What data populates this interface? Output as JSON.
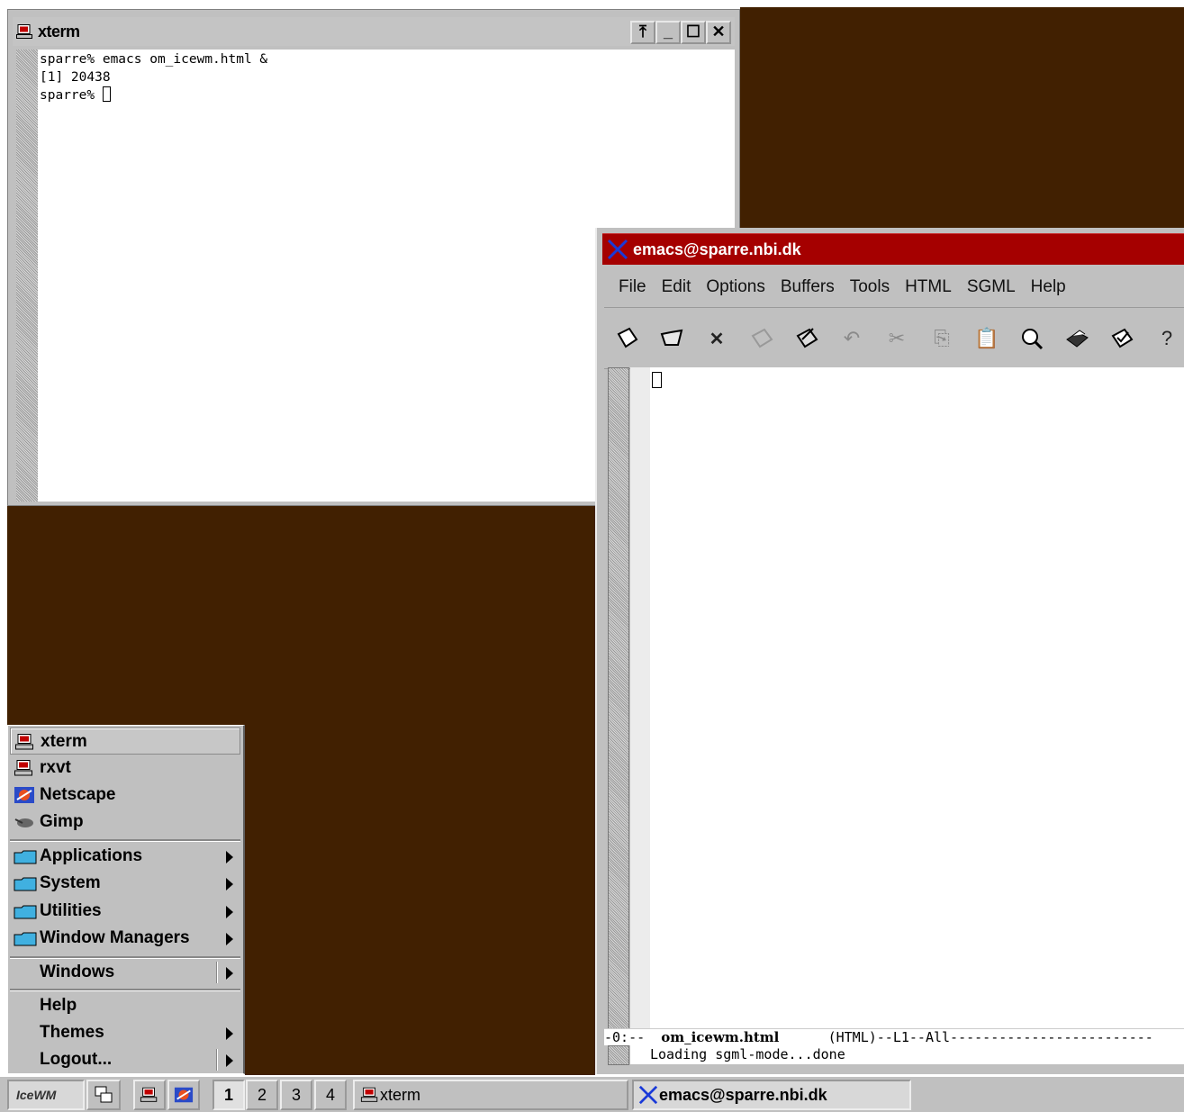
{
  "xterm": {
    "title": "xterm",
    "lines": [
      "sparre% emacs om_icewm.html &",
      "[1] 20438",
      "sparre% "
    ],
    "buttons": [
      "⤒",
      "_",
      "☐",
      "✕"
    ]
  },
  "emacs": {
    "title": "emacs@sparre.nbi.dk",
    "menu": [
      "File",
      "Edit",
      "Options",
      "Buffers",
      "Tools",
      "HTML",
      "SGML",
      "Help"
    ],
    "modeline_prefix": "-0:--  ",
    "modeline_buffer": "om_icewm.html",
    "modeline_rest": "      (HTML)--L1--All-------------------------",
    "minibuffer": "Loading sgml-mode...done"
  },
  "menu": {
    "items": [
      {
        "label": "xterm",
        "underline": "x"
      },
      {
        "label": "rxvt",
        "underline": "r"
      },
      {
        "label": "Netscape",
        "underline": "N"
      },
      {
        "label": "Gimp",
        "underline": "G"
      }
    ],
    "folders": [
      {
        "label": "Applications",
        "underline": "A"
      },
      {
        "label": "System",
        "underline": "S"
      },
      {
        "label": "Utilities",
        "underline": "U"
      },
      {
        "label": "Window Managers",
        "underline": "W"
      }
    ],
    "windows": "Windows",
    "help": "Help",
    "themes": "Themes",
    "logout": "Logout..."
  },
  "taskbar": {
    "logo": "IceWM",
    "workspaces": [
      "1",
      "2",
      "3",
      "4"
    ],
    "tasks": [
      "xterm",
      "emacs@sparre.nbi.dk"
    ]
  },
  "colors": {
    "desktop": "#412001",
    "emacs_titlebar": "#a50000",
    "chrome": "#c0c0c0"
  }
}
